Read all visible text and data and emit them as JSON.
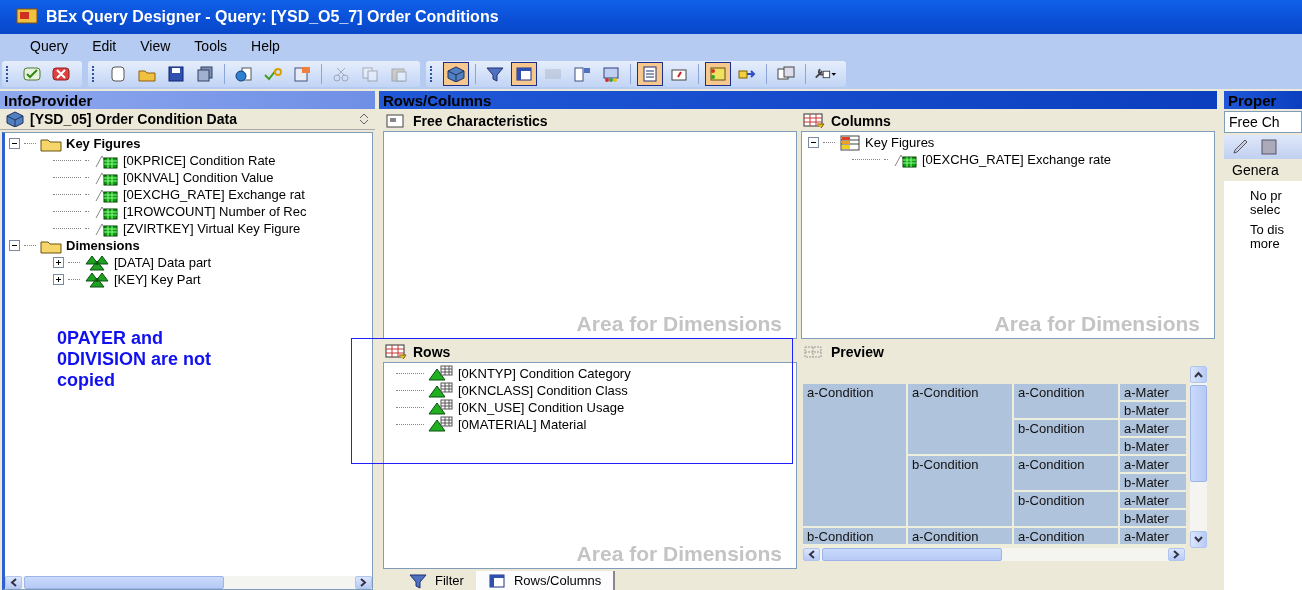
{
  "window": {
    "title": "BEx Query Designer - Query: [YSD_O5_7] Order Conditions"
  },
  "menu": [
    "Query",
    "Edit",
    "View",
    "Tools",
    "Help"
  ],
  "toolbar": [
    [
      {
        "kind": "check",
        "pressed": false,
        "disabled": false
      },
      {
        "kind": "cancel",
        "pressed": false,
        "disabled": false
      }
    ],
    [
      {
        "kind": "new",
        "pressed": false,
        "disabled": false
      },
      {
        "kind": "open",
        "pressed": false,
        "disabled": false
      },
      {
        "kind": "save",
        "pressed": false,
        "disabled": false
      },
      {
        "kind": "saveall",
        "pressed": false,
        "disabled": false
      },
      {
        "kind": "sep"
      },
      {
        "kind": "globe",
        "pressed": false,
        "disabled": false
      },
      {
        "kind": "checkq",
        "pressed": false,
        "disabled": false
      },
      {
        "kind": "props",
        "pressed": false,
        "disabled": false
      },
      {
        "kind": "sep"
      },
      {
        "kind": "cut",
        "pressed": false,
        "disabled": true
      },
      {
        "kind": "copy",
        "pressed": false,
        "disabled": true
      },
      {
        "kind": "paste",
        "pressed": false,
        "disabled": true
      }
    ],
    [
      {
        "kind": "cube",
        "pressed": true,
        "disabled": false
      },
      {
        "kind": "sep"
      },
      {
        "kind": "filter",
        "pressed": false,
        "disabled": false
      },
      {
        "kind": "table",
        "pressed": true,
        "disabled": false
      },
      {
        "kind": "cells",
        "pressed": false,
        "disabled": true
      },
      {
        "kind": "conditions",
        "pressed": false,
        "disabled": false
      },
      {
        "kind": "monitor",
        "pressed": false,
        "disabled": false
      },
      {
        "kind": "sep"
      },
      {
        "kind": "docs",
        "pressed": true,
        "disabled": false
      },
      {
        "kind": "tag",
        "pressed": false,
        "disabled": false
      },
      {
        "kind": "sep"
      },
      {
        "kind": "tasks",
        "pressed": true,
        "disabled": false
      },
      {
        "kind": "export",
        "pressed": false,
        "disabled": false
      },
      {
        "kind": "sep"
      },
      {
        "kind": "multi",
        "pressed": false,
        "disabled": false
      },
      {
        "kind": "sep"
      },
      {
        "kind": "tools",
        "pressed": false,
        "disabled": false
      }
    ]
  ],
  "infoprovider": {
    "title": "InfoProvider",
    "selector": "[YSD_05] Order Condition Data",
    "tree": [
      {
        "label": "Key Figures",
        "kind": "folder",
        "expanded": true,
        "children": [
          {
            "label": "[0KPRICE] Condition Rate",
            "kind": "keyfigure"
          },
          {
            "label": "[0KNVAL] Condition Value",
            "kind": "keyfigure"
          },
          {
            "label": "[0EXCHG_RATE] Exchange rat",
            "kind": "keyfigure"
          },
          {
            "label": "[1ROWCOUNT] Number of Rec",
            "kind": "keyfigure"
          },
          {
            "label": "[ZVIRTKEY] Virtual Key Figure",
            "kind": "keyfigure"
          }
        ]
      },
      {
        "label": "Dimensions",
        "kind": "folder",
        "expanded": true,
        "children": [
          {
            "label": "[DATA] Data part",
            "kind": "dimension",
            "expanded": false
          },
          {
            "label": "[KEY] Key Part",
            "kind": "dimension",
            "expanded": false
          }
        ]
      }
    ]
  },
  "note": "0PAYER and 0DIVISION are not copied",
  "rows_columns": {
    "title": "Rows/Columns",
    "free_characteristics": {
      "title": "Free Characteristics",
      "watermark": "Area for Dimensions"
    },
    "columns": {
      "title": "Columns",
      "watermark": "Area for Dimensions",
      "tree": [
        {
          "label": "Key Figures",
          "kind": "structure",
          "expanded": true,
          "children": [
            {
              "label": "[0EXCHG_RATE] Exchange rate",
              "kind": "keyfigure"
            }
          ]
        }
      ]
    },
    "rows": {
      "title": "Rows",
      "watermark": "Area for Dimensions",
      "items": [
        "[0KNTYP] Condition Category",
        "[0KNCLASS] Condition Class",
        "[0KN_USE] Condition Usage",
        "[0MATERIAL] Material"
      ]
    },
    "preview": {
      "title": "Preview",
      "rows": [
        {
          "text": "a-Condition",
          "children": [
            {
              "text": "a-Condition",
              "children": [
                {
                  "text": "a-Condition",
                  "children": [
                    {
                      "text": "a-Mater"
                    },
                    {
                      "text": "b-Mater"
                    }
                  ]
                },
                {
                  "text": "b-Condition",
                  "children": [
                    {
                      "text": "a-Mater"
                    },
                    {
                      "text": "b-Mater"
                    }
                  ]
                }
              ]
            },
            {
              "text": "b-Condition",
              "children": [
                {
                  "text": "a-Condition",
                  "children": [
                    {
                      "text": "a-Mater"
                    },
                    {
                      "text": "b-Mater"
                    }
                  ]
                },
                {
                  "text": "b-Condition",
                  "children": [
                    {
                      "text": "a-Mater"
                    },
                    {
                      "text": "b-Mater"
                    }
                  ]
                }
              ]
            }
          ]
        },
        {
          "text": "b-Condition",
          "children": [
            {
              "text": "a-Condition",
              "children": [
                {
                  "text": "a-Condition",
                  "children": [
                    {
                      "text": "a-Mater"
                    }
                  ]
                }
              ]
            }
          ]
        }
      ]
    },
    "tabs": [
      {
        "label": "Filter",
        "kind": "filter",
        "selected": false
      },
      {
        "label": "Rows/Columns",
        "kind": "table",
        "selected": true
      }
    ]
  },
  "properties": {
    "title": "Proper",
    "selector": "Free Ch",
    "tab": "Genera",
    "message": [
      "No pr",
      "selec",
      "To dis",
      "more"
    ]
  }
}
